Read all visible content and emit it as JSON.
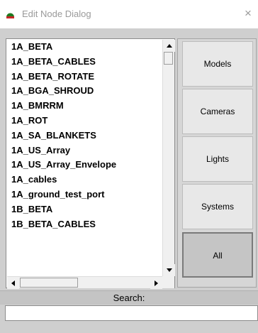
{
  "window": {
    "title": "Edit Node Dialog",
    "close_glyph": "×",
    "icon": "green-node-icon"
  },
  "node_list": {
    "items": [
      "1A_BETA",
      "1A_BETA_CABLES",
      "1A_BETA_ROTATE",
      "1A_BGA_SHROUD",
      "1A_BMRRM",
      "1A_ROT",
      "1A_SA_BLANKETS",
      "1A_US_Array",
      "1A_US_Array_Envelope",
      "1A_cables",
      "1A_ground_test_port",
      "1B_BETA",
      "1B_BETA_CABLES"
    ]
  },
  "filters": {
    "buttons": [
      "Models",
      "Cameras",
      "Lights",
      "Systems",
      "All"
    ],
    "selected": "All"
  },
  "search": {
    "label": "Search:",
    "value": ""
  },
  "colors": {
    "panel_bg": "#cfcfcf",
    "icon_green": "#1f7a1f"
  }
}
